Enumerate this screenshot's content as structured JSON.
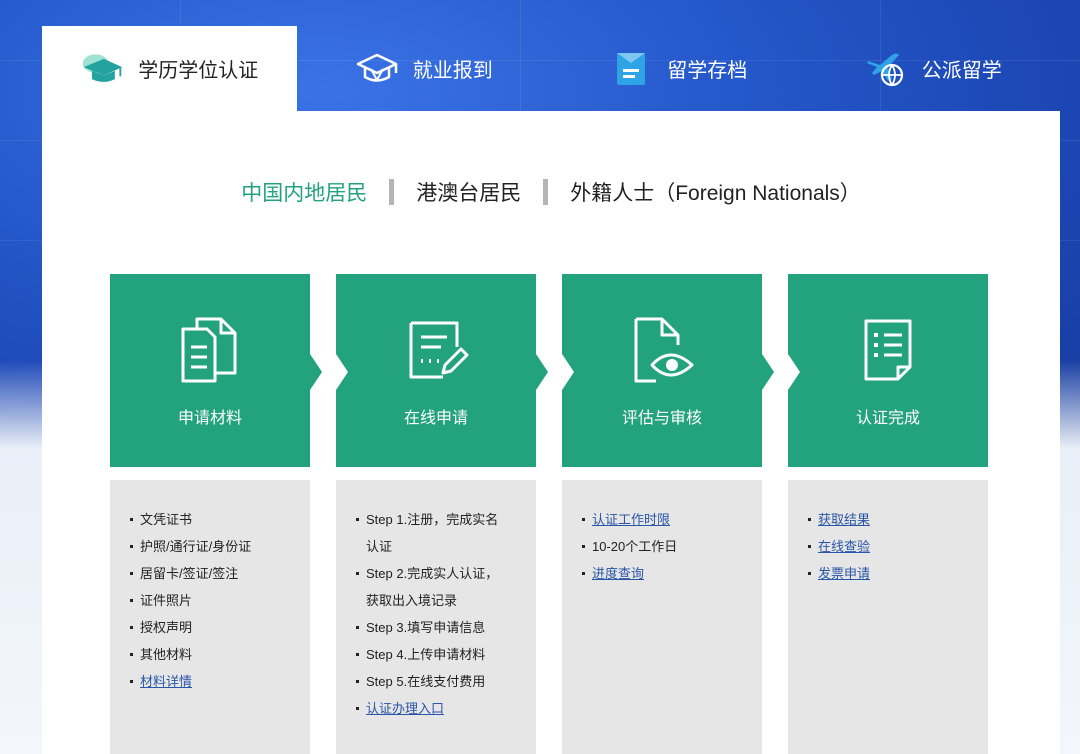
{
  "tabs": [
    {
      "label": "学历学位认证",
      "icon": "graduation-cap-icon",
      "active": true
    },
    {
      "label": "就业报到",
      "icon": "cap-outline-icon",
      "active": false
    },
    {
      "label": "留学存档",
      "icon": "archive-folder-icon",
      "active": false
    },
    {
      "label": "公派留学",
      "icon": "plane-globe-icon",
      "active": false
    }
  ],
  "subnav": {
    "items": [
      "中国内地居民",
      "港澳台居民",
      "外籍人士（Foreign Nationals）"
    ],
    "active_index": 0
  },
  "steps": [
    {
      "label": "申请材料",
      "icon": "documents-icon"
    },
    {
      "label": "在线申请",
      "icon": "form-edit-icon"
    },
    {
      "label": "评估与审核",
      "icon": "document-eye-icon"
    },
    {
      "label": "认证完成",
      "icon": "checklist-icon"
    }
  ],
  "details": {
    "materials": {
      "items": [
        "文凭证书",
        "护照/通行证/身份证",
        "居留卡/签证/签注",
        "证件照片",
        "授权声明",
        "其他材料"
      ],
      "link": "材料详情"
    },
    "online": {
      "step1a": "Step 1.注册，完成实名",
      "step1b": "认证",
      "step2a": "Step 2.完成实人认证，",
      "step2b": "获取出入境记录",
      "step3": "Step 3.填写申请信息",
      "step4": "Step 4.上传申请材料",
      "step5": "Step 5.在线支付费用",
      "link": "认证办理入口"
    },
    "review": {
      "link1": "认证工作时限",
      "text": "10-20个工作日",
      "link2": "进度查询"
    },
    "complete": {
      "link1": "获取结果",
      "link2": "在线查验",
      "link3": "发票申请"
    }
  },
  "colors": {
    "accent_green": "#22a37d",
    "link_blue": "#2a56a8",
    "hero_blue": "#2457c9"
  }
}
